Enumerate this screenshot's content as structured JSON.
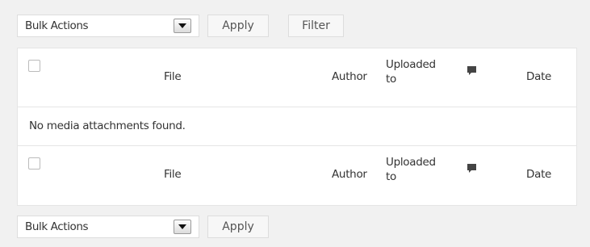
{
  "top_nav": {
    "bulk_actions_label": "Bulk Actions",
    "apply_label": "Apply",
    "filter_label": "Filter"
  },
  "table": {
    "columns": {
      "file": "File",
      "author": "Author",
      "uploaded_line1": "Uploaded",
      "uploaded_line2": "to",
      "date": "Date"
    },
    "empty_message": "No media attachments found."
  },
  "bottom_nav": {
    "bulk_actions_label": "Bulk Actions",
    "apply_label": "Apply"
  },
  "icons": {
    "select_arrow": "chevron-down-icon",
    "comments": "comment-bubble-icon"
  },
  "colors": {
    "background": "#f1f1f1",
    "table_background": "#ffffff",
    "border": "#e5e5e5",
    "comment_icon": "#444444"
  }
}
